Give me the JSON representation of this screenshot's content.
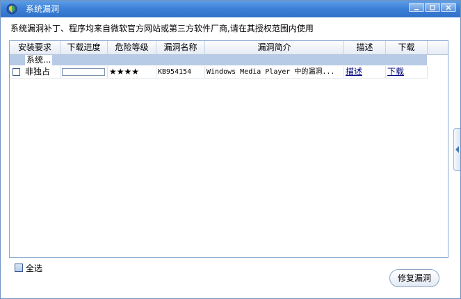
{
  "window": {
    "title": "系统漏洞",
    "title_icon": "shield-globe-icon",
    "controls": [
      "minimize-icon",
      "maximize-icon",
      "close-icon"
    ]
  },
  "notice": "系统漏洞补丁、程序均来自微软官方网站或第三方软件厂商,请在其授权范围内使用",
  "table": {
    "columns": [
      "安装要求",
      "下载进度",
      "危险等级",
      "漏洞名称",
      "漏洞简介",
      "描述",
      "下载"
    ],
    "group_label": "系统...",
    "rows": [
      {
        "requirement": "非独占",
        "progress": 0,
        "danger": "★★★★",
        "name": "KB954154",
        "summary": "Windows Media Player 中的漏洞...",
        "describe": "描述",
        "download": "下载"
      }
    ]
  },
  "select_all": "全选",
  "fix_button": "修复漏洞",
  "colors": {
    "titlebar": "#3d82d8",
    "group_row": "#b7cae6",
    "link": "#000080",
    "border": "#8aa8d0"
  }
}
